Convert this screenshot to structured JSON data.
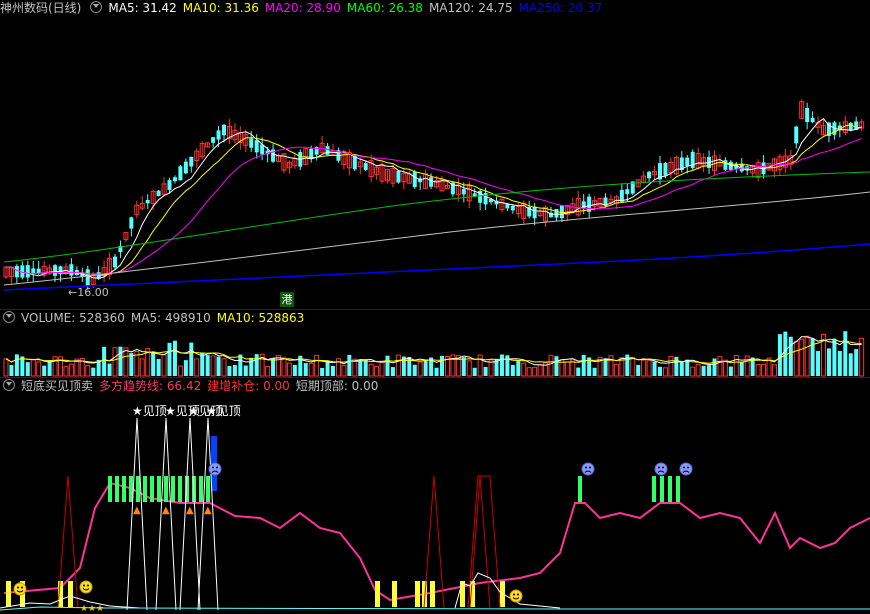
{
  "price_panel": {
    "title": "神州数码(日线)",
    "ma": [
      {
        "label": "MA5: 31.42",
        "color": "#ffffff"
      },
      {
        "label": "MA10: 31.36",
        "color": "#ffff00"
      },
      {
        "label": "MA20: 28.90",
        "color": "#ff00ff"
      },
      {
        "label": "MA60: 26.38",
        "color": "#00ff00"
      },
      {
        "label": "MA120: 24.75",
        "color": "#c0c0c0"
      },
      {
        "label": "MA250: 20.37",
        "color": "#0000ff"
      }
    ],
    "low_marker": "16.00",
    "hk_badge": "港"
  },
  "volume_panel": {
    "items": [
      {
        "label": "VOLUME: 528360",
        "color": "#c0c0c0"
      },
      {
        "label": "MA5: 498910",
        "color": "#c0c0c0"
      },
      {
        "label": "MA10: 528863",
        "color": "#ffff00"
      }
    ]
  },
  "indicator_panel": {
    "items": [
      {
        "label": "短底买见顶卖",
        "color": "#c0c0c0"
      },
      {
        "label": "多方趋势线: 66.42",
        "color": "#ff3366"
      },
      {
        "label": "建增补仓: 0.00",
        "color": "#ff3333"
      },
      {
        "label": "短期顶部: 0.00",
        "color": "#c0c0c0"
      }
    ],
    "top_signal": "★见顶",
    "top_signal_count": 4
  },
  "colors": {
    "up": "#ff3232",
    "down": "#54ffff",
    "separator": "#7a0000",
    "trend": "#ff3399",
    "bars_green": "#33ff66",
    "bars_yellow": "#ffff33",
    "bars_blue": "#0044ff"
  }
}
